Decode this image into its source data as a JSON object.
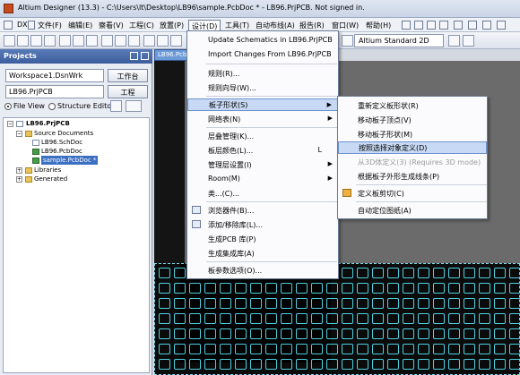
{
  "window": {
    "title": "Altium Designer (13.3) - C:\\Users\\lt\\Desktop\\LB96\\sample.PcbDoc * - LB96.PrjPCB. Not signed in."
  },
  "menubar": {
    "items": [
      {
        "label": "DXP"
      },
      {
        "label": "文件(F)"
      },
      {
        "label": "编辑(E)"
      },
      {
        "label": "察看(V)"
      },
      {
        "label": "工程(C)"
      },
      {
        "label": "放置(P)"
      },
      {
        "label": "设计(D)"
      },
      {
        "label": "工具(T)"
      },
      {
        "label": "自动布线(A)"
      },
      {
        "label": "报告(R)"
      },
      {
        "label": "窗口(W)"
      },
      {
        "label": "帮助(H)"
      }
    ]
  },
  "toolbar": {
    "view_mode": "Altium Standard 2D"
  },
  "projects_panel": {
    "title": "Projects",
    "workspace_value": "Workspace1.DsnWrk",
    "workspace_button": "工作台",
    "project_value": "LB96.PrjPCB",
    "project_button": "工程",
    "file_view_label": "File View",
    "structure_editor_label": "Structure Editor",
    "tree": {
      "project": "LB96.PrjPCB",
      "source_documents": "Source Documents",
      "schdoc": "LB96.SchDoc",
      "pcbdoc": "LB96.PcbDoc",
      "sample_pcbdoc": "sample.PcbDoc *",
      "libraries": "Libraries",
      "generated": "Generated"
    }
  },
  "document_tab": {
    "label": "LB96.PcbDoc"
  },
  "design_menu": {
    "items": [
      {
        "label": "Update Schematics in LB96.PrjPCB"
      },
      {
        "label": "Import Changes From LB96.PrjPCB"
      },
      {
        "label": "规则(R)..."
      },
      {
        "label": "规则向导(W)..."
      },
      {
        "label": "板子形状(S)"
      },
      {
        "label": "网络表(N)"
      },
      {
        "label": "层叠管理(K)..."
      },
      {
        "label": "板层颜色(L)...",
        "shortcut": "L"
      },
      {
        "label": "管理层设置(I)"
      },
      {
        "label": "Room(M)"
      },
      {
        "label": "类...(C)..."
      },
      {
        "label": "浏览器件(B)..."
      },
      {
        "label": "添加/移除库(L)..."
      },
      {
        "label": "生成PCB 库(P)"
      },
      {
        "label": "生成集成库(A)"
      },
      {
        "label": "板参数选项(O)..."
      }
    ]
  },
  "board_shape_submenu": {
    "items": [
      {
        "label": "重新定义板形状(R)"
      },
      {
        "label": "移动板子顶点(V)"
      },
      {
        "label": "移动板子形状(M)"
      },
      {
        "label": "按照选择对象定义(D)"
      },
      {
        "label": "从3D体定义(3) (Requires 3D mode)"
      },
      {
        "label": "根据板子外形生成线条(P)"
      },
      {
        "label": "定义板剪切(C)"
      },
      {
        "label": "自动定位图纸(A)"
      }
    ]
  },
  "colors": {
    "menu_highlight": "#c7d9f4",
    "panel_header": "#3b5d9c",
    "board_outline": "#4fd0e0",
    "canvas": "#6b6b6b"
  }
}
